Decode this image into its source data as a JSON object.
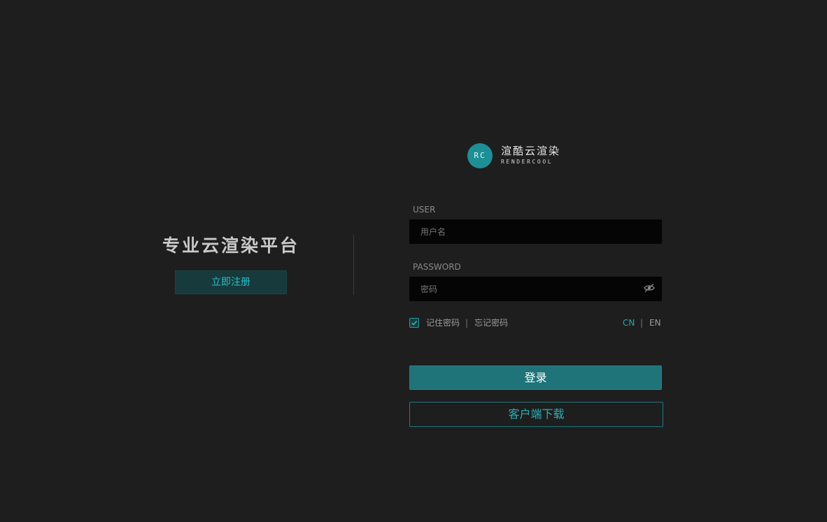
{
  "left": {
    "tagline": "专业云渲染平台",
    "register_label": "立即注册"
  },
  "logo": {
    "mark_text": "RC",
    "name_cn": "渲酷云渲染",
    "name_en": "RENDERCOOL"
  },
  "form": {
    "user_label": "USER",
    "user_placeholder": "用户名",
    "user_value": "",
    "password_label": "PASSWORD",
    "password_placeholder": "密码",
    "password_value": "",
    "remember_label": "记住密码",
    "remember_checked": true,
    "separator": "|",
    "forgot_label": "忘记密码",
    "lang_cn": "CN",
    "lang_en": "EN",
    "active_lang": "CN",
    "login_label": "登录",
    "download_label": "客户端下载"
  },
  "icons": {
    "password_toggle": "eye-slash-icon",
    "remember": "checkmark-icon"
  },
  "colors": {
    "background": "#1e1e1e",
    "accent": "#1e7479",
    "accent_text": "#2aa7ad",
    "input_bg": "#050505"
  }
}
